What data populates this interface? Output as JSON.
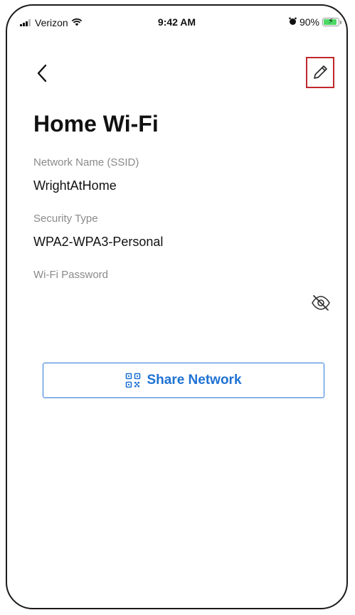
{
  "status_bar": {
    "carrier": "Verizon",
    "time": "9:42 AM",
    "battery": "90%",
    "battery_level": 0.9,
    "icons": [
      "signal-icon",
      "wifi-icon",
      "alarm-icon",
      "battery-charging-icon"
    ]
  },
  "nav": {
    "back_icon": "chevron-left-icon",
    "edit_icon": "pencil-icon",
    "edit_highlight_color": "#c0272d"
  },
  "page": {
    "title": "Home Wi-Fi"
  },
  "fields": {
    "ssid_label": "Network Name (SSID)",
    "ssid_value": "WrightAtHome",
    "security_label": "Security Type",
    "security_value": "WPA2-WPA3-Personal",
    "password_label": "Wi-Fi Password",
    "password_value": "",
    "password_toggle_icon": "eye-off-icon"
  },
  "share": {
    "label": "Share Network",
    "icon": "qr-code-icon",
    "color": "#1f72d3"
  }
}
